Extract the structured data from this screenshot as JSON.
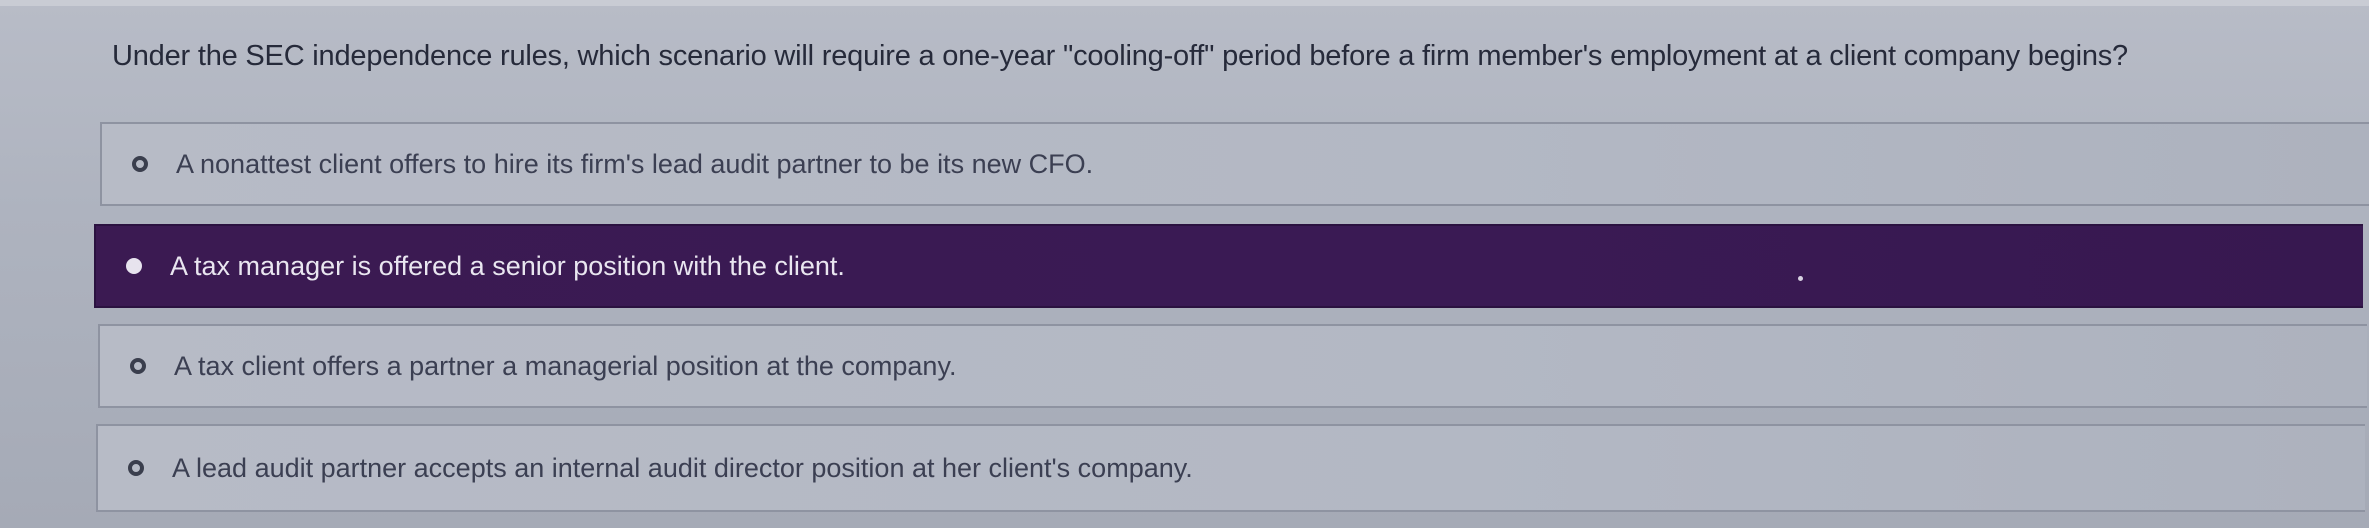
{
  "question": {
    "text": "Under the SEC independence rules, which scenario will require a one-year \"cooling-off\" period before a firm member's employment at a client company begins?"
  },
  "options": [
    {
      "label": "A nonattest client offers to hire its firm's lead audit partner to be its new CFO.",
      "selected": false
    },
    {
      "label": "A tax manager is offered a senior position with the client.",
      "selected": true
    },
    {
      "label": "A tax client offers a partner a managerial position at the company.",
      "selected": false
    },
    {
      "label": "A lead audit partner accepts an internal audit director position at her client's company.",
      "selected": false
    }
  ],
  "colors": {
    "selected_background": "#3a1a54",
    "background": "#b3b8c4",
    "text": "#262a3a"
  }
}
